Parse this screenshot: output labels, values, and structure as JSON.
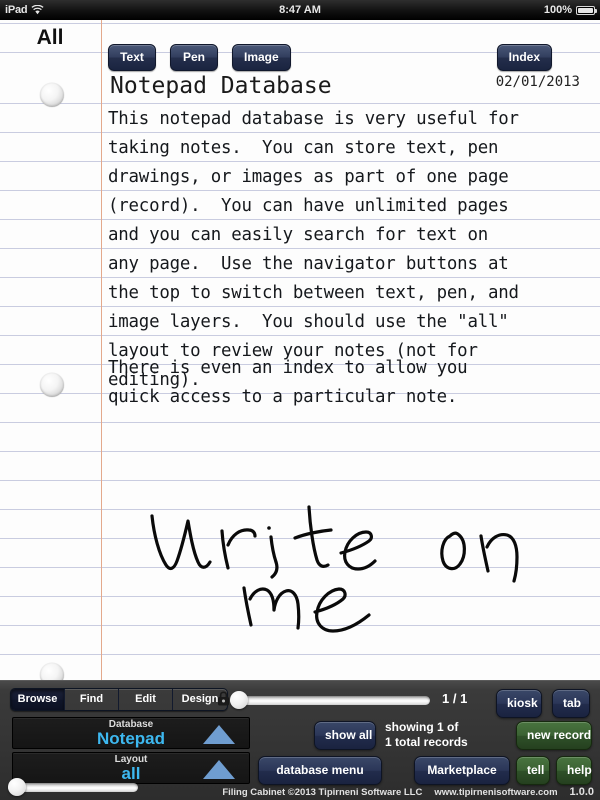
{
  "statusbar": {
    "carrier": "iPad",
    "wifi_icon": "wifi-icon",
    "time": "8:47 AM",
    "battery_pct": "100%",
    "battery_icon": "battery-full-icon"
  },
  "page": {
    "layout_label": "All",
    "title": "Notepad Database",
    "date": "02/01/2013",
    "navigator": [
      {
        "label": "Text",
        "name": "text-layer-button"
      },
      {
        "label": "Pen",
        "name": "pen-layer-button"
      },
      {
        "label": "Image",
        "name": "image-layer-button"
      }
    ],
    "index_label": "Index",
    "body_paragraph_1": "This notepad database is very useful for\ntaking notes.  You can store text, pen\ndrawings, or images as part of one page\n(record).  You can have unlimited pages\nand you can easily search for text on\nany page.  Use the navigator buttons at\nthe top to switch between text, pen, and\nimage layers.  You should use the \"all\"\nlayout to review your notes (not for\nediting).",
    "body_paragraph_2": "There is even an index to allow you\nquick access to a particular note.",
    "handwriting": "write on me"
  },
  "deck": {
    "segments": [
      {
        "label": "Browse",
        "selected": true
      },
      {
        "label": "Find",
        "selected": false
      },
      {
        "label": "Edit",
        "selected": false
      },
      {
        "label": "Design",
        "selected": false,
        "locked": true
      }
    ],
    "page_slider": {
      "value": 0,
      "page_count_label": "1 / 1"
    },
    "kiosk_label": "kiosk",
    "tab_label": "tab",
    "database": {
      "label": "Database",
      "value": "Notepad"
    },
    "layout": {
      "label": "Layout",
      "value": "all"
    },
    "show_all_label": "show all",
    "showing_line1": "showing 1 of",
    "showing_line2": "1 total records",
    "new_record_label": "new record",
    "database_menu_label": "database menu",
    "marketplace_label": "Marketplace",
    "tell_label": "tell",
    "help_label": "help",
    "zoom_slider": {
      "value": 0
    }
  },
  "footer": {
    "copyright": "Filing Cabinet ©2013 Tipirneni Software LLC",
    "website": "www.tipirnenisoftware.com",
    "version": "1.0.0"
  },
  "colors": {
    "accent_blue": "#3db8f0",
    "button_blue": "#2b3658",
    "button_green": "#3b6233",
    "paper": "#fdfdfd",
    "rule_line": "#c9cce0",
    "margin_line": "#e3a98c"
  }
}
